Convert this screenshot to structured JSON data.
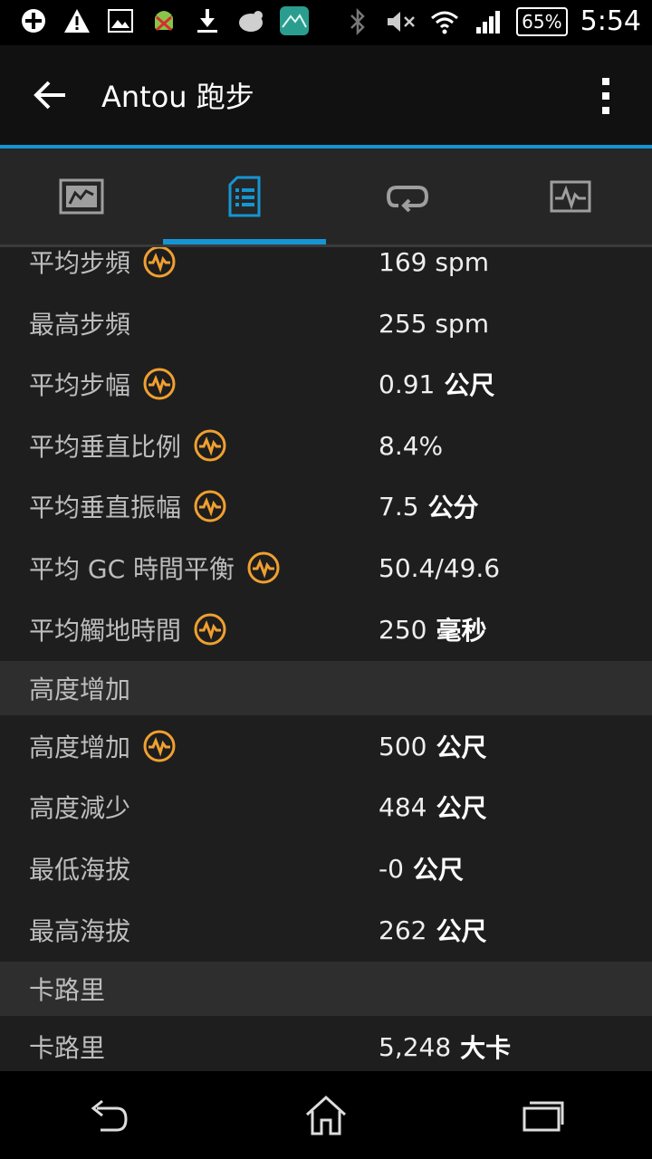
{
  "status_bar": {
    "battery": "65%",
    "time": "5:54",
    "left_icons": [
      "plus-icon",
      "warning-icon",
      "image-icon",
      "android-icon",
      "download-icon",
      "bird-icon",
      "mountain-app-icon"
    ],
    "right_icons": [
      "bluetooth-icon",
      "mute-icon",
      "wifi-icon",
      "signal-icon"
    ]
  },
  "app_bar": {
    "title": "Antou 跑步"
  },
  "tabs": [
    "chart-tab",
    "details-tab",
    "laps-tab",
    "graph-tab"
  ],
  "stats_group1": [
    {
      "label": "平均步頻",
      "num": "169 spm",
      "unit": "",
      "badge": true
    },
    {
      "label": "最高步頻",
      "num": "255 spm",
      "unit": "",
      "badge": false
    },
    {
      "label": "平均步幅",
      "num": "0.91",
      "unit": "公尺",
      "badge": true
    },
    {
      "label": "平均垂直比例",
      "num": "8.4%",
      "unit": "",
      "badge": true
    },
    {
      "label": "平均垂直振幅",
      "num": "7.5",
      "unit": "公分",
      "badge": true
    },
    {
      "label": "平均 GC 時間平衡",
      "num": "50.4/49.6",
      "unit": "",
      "badge": true
    },
    {
      "label": "平均觸地時間",
      "num": "250",
      "unit": "毫秒",
      "badge": true
    }
  ],
  "section_elevation": {
    "label": "高度增加"
  },
  "stats_elevation": [
    {
      "label": "高度增加",
      "num": "500",
      "unit": "公尺",
      "badge": true
    },
    {
      "label": "高度減少",
      "num": "484",
      "unit": "公尺",
      "badge": false
    },
    {
      "label": "最低海拔",
      "num": "-0",
      "unit": "公尺",
      "badge": false
    },
    {
      "label": "最高海拔",
      "num": "262",
      "unit": "公尺",
      "badge": false
    }
  ],
  "section_calories": {
    "label": "卡路里"
  },
  "stats_calories": [
    {
      "label": "卡路里",
      "num": "5,248",
      "unit": "大卡",
      "badge": false
    }
  ],
  "colors": {
    "accent": "#1596d2",
    "badge": "#f0a030"
  }
}
